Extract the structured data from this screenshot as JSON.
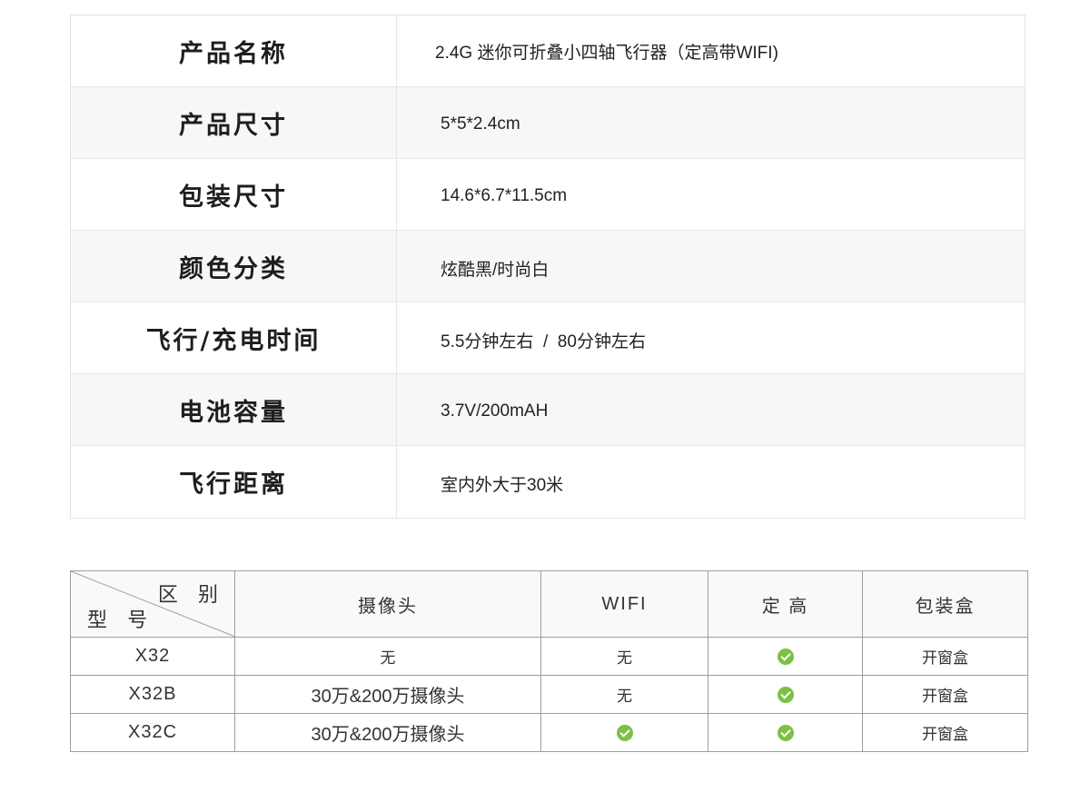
{
  "spec_table": [
    {
      "label": "产品名称",
      "value": "2.4G 迷你可折叠小四轴飞行器（定高带WIFI)"
    },
    {
      "label": "产品尺寸",
      "value": "5*5*2.4cm"
    },
    {
      "label": "包装尺寸",
      "value": "14.6*6.7*11.5cm"
    },
    {
      "label": "颜色分类",
      "value": "炫酷黑/时尚白"
    },
    {
      "label": "飞行/充电时间",
      "value": "5.5分钟左右  /  80分钟左右"
    },
    {
      "label": "电池容量",
      "value": "3.7V/200mAH"
    },
    {
      "label": "飞行距离",
      "value": "室内外大于30米"
    }
  ],
  "compare_table": {
    "corner_top": "区 别",
    "corner_bottom": "型 号",
    "headers": [
      "摄像头",
      "WIFI",
      "定 高",
      "包装盒"
    ],
    "check_color": "#7dc144",
    "rows": [
      {
        "model": "X32",
        "camera": "无",
        "wifi": "无",
        "altitude_hold": "check-icon",
        "box": "开窗盒"
      },
      {
        "model": "X32B",
        "camera": "30万&200万摄像头",
        "wifi": "无",
        "altitude_hold": "check-icon",
        "box": "开窗盒"
      },
      {
        "model": "X32C",
        "camera": "30万&200万摄像头",
        "wifi": "check-icon",
        "altitude_hold": "check-icon",
        "box": "开窗盒"
      }
    ]
  }
}
